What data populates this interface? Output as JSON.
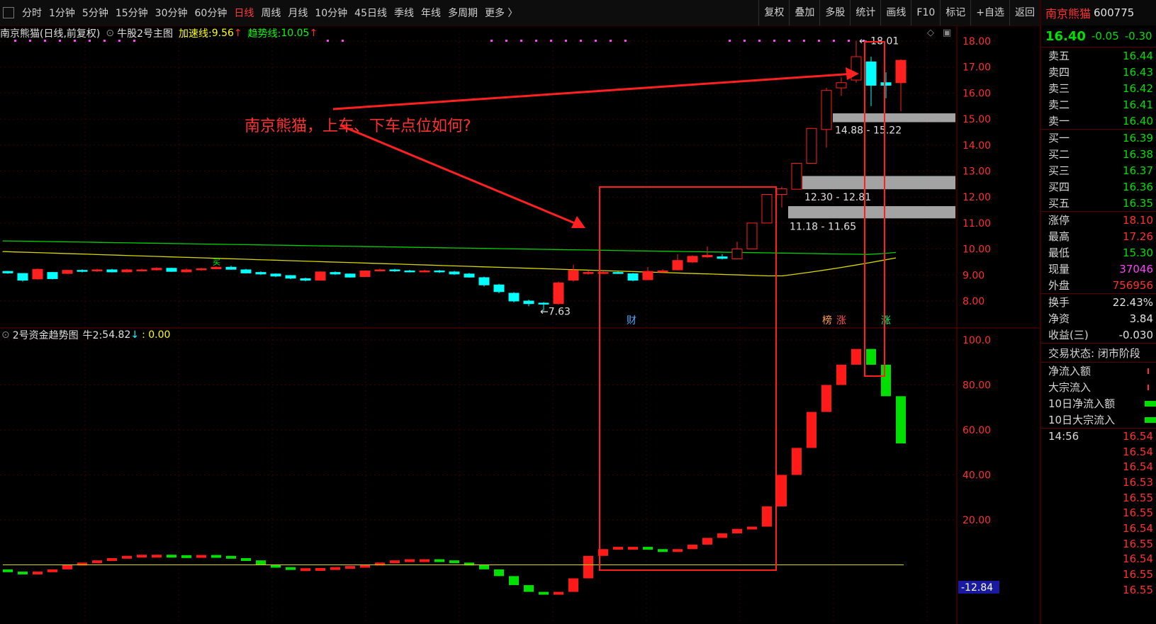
{
  "toolbar": {
    "items": [
      "分时",
      "1分钟",
      "5分钟",
      "15分钟",
      "30分钟",
      "60分钟",
      "日线",
      "周线",
      "月线",
      "10分钟",
      "45日线",
      "季线",
      "年线",
      "多周期",
      "更多 〉"
    ],
    "active": "日线",
    "right_buttons": [
      "复权",
      "叠加",
      "多股",
      "统计",
      "画线",
      "F10",
      "标记",
      "+自选",
      "返回"
    ]
  },
  "main_chart": {
    "stock_title": "南京熊猫(日线,前复权)",
    "indicator_name": "牛股2号主图",
    "accel_label": "加速线:",
    "accel_value": "9.56",
    "trend_label": "趋势线:",
    "trend_value": "10.05",
    "price_ticks": [
      "18.00",
      "17.00",
      "16.00",
      "15.00",
      "14.00",
      "13.00",
      "12.00",
      "11.00",
      "10.00",
      "9.00",
      "8.00"
    ],
    "annotation_text": "南京熊猫，上车、下车点位如何?",
    "high_label": "18.01",
    "low_label": "7.63",
    "zone_labels": [
      "14.88 - 15.22",
      "12.30 - 12.81",
      "11.18 - 11.65"
    ],
    "markers": [
      "财",
      "榜",
      "涨",
      "涨"
    ],
    "buy_mark": "买"
  },
  "sub_chart": {
    "title": "2号资金趋势图",
    "niu_label": "牛2:",
    "niu_value": "54.82",
    "extra": ": 0.00",
    "ticks": [
      "100.0",
      "80.00",
      "60.00",
      "40.00",
      "20.00"
    ],
    "bottom_value": "-12.84"
  },
  "colors": {
    "up": "#ff2020",
    "down": "#00ffff",
    "flow_up": "#ff1a1a",
    "flow_down": "#00e000",
    "accent": "#ff3030"
  },
  "chart_data": [
    {
      "type": "candlestick",
      "title": "南京熊猫(日线,前复权)",
      "ylim": [
        7.5,
        18.5
      ],
      "series": [
        {
          "name": "加速线",
          "last": 9.56
        },
        {
          "name": "趋势线",
          "last": 10.05
        }
      ],
      "high": 18.01,
      "low": 7.63
    },
    {
      "type": "bar",
      "title": "2号资金趋势图",
      "ylim": [
        -12.84,
        100
      ],
      "last": 54.82
    }
  ],
  "quote": {
    "name": "南京熊猫",
    "code": "600775",
    "price": "16.40",
    "change": "-0.05",
    "change_pct": "-0.30",
    "asks": [
      {
        "label": "卖五",
        "price": "16.44"
      },
      {
        "label": "卖四",
        "price": "16.43"
      },
      {
        "label": "卖三",
        "price": "16.42"
      },
      {
        "label": "卖二",
        "price": "16.41"
      },
      {
        "label": "卖一",
        "price": "16.40"
      }
    ],
    "bids": [
      {
        "label": "买一",
        "price": "16.39"
      },
      {
        "label": "买二",
        "price": "16.38"
      },
      {
        "label": "买三",
        "price": "16.37"
      },
      {
        "label": "买四",
        "price": "16.36"
      },
      {
        "label": "买五",
        "price": "16.35"
      }
    ],
    "stats": [
      {
        "label": "涨停",
        "value": "18.10",
        "color": "red"
      },
      {
        "label": "最高",
        "value": "17.26",
        "color": "red"
      },
      {
        "label": "最低",
        "value": "15.30",
        "color": "green"
      },
      {
        "label": "现量",
        "value": "37046",
        "color": "magenta"
      },
      {
        "label": "外盘",
        "value": "756956",
        "color": "red"
      }
    ],
    "stats2": [
      {
        "label": "换手",
        "value": "22.43%",
        "color": "white"
      },
      {
        "label": "净资",
        "value": "3.84",
        "color": "white"
      },
      {
        "label": "收益(三)",
        "value": "-0.030",
        "color": "white"
      }
    ],
    "trade_status": "交易状态: 闭市阶段",
    "flows": [
      "净流入额",
      "大宗流入",
      "10日净流入额",
      "10日大宗流入"
    ],
    "tick_time": "14:56",
    "ticks": [
      "16.54",
      "16.54",
      "16.54",
      "16.53",
      "16.55",
      "16.55",
      "16.54",
      "16.55",
      "16.54",
      "16.55",
      "16.55"
    ]
  }
}
